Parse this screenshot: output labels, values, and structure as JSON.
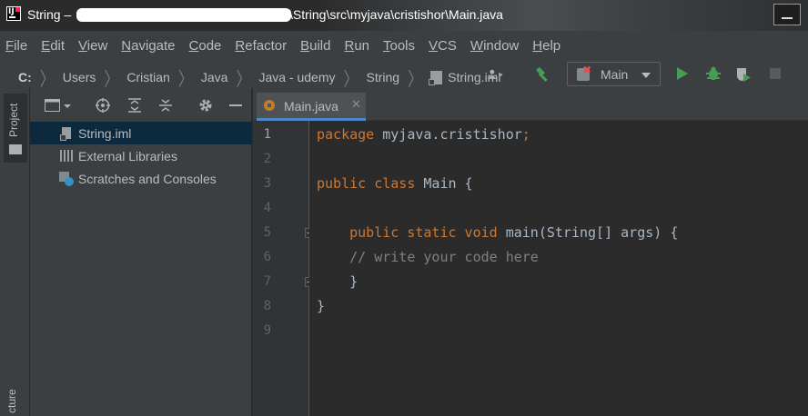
{
  "window": {
    "title_prefix": "String –",
    "title_path": "\\String\\src\\myjava\\cristishor\\Main.java"
  },
  "menu": [
    {
      "label": "File",
      "mnemonic": "F",
      "rest": "ile"
    },
    {
      "label": "Edit",
      "mnemonic": "E",
      "rest": "dit"
    },
    {
      "label": "View",
      "mnemonic": "V",
      "rest": "iew"
    },
    {
      "label": "Navigate",
      "mnemonic": "N",
      "rest": "avigate"
    },
    {
      "label": "Code",
      "mnemonic": "C",
      "rest": "ode"
    },
    {
      "label": "Refactor",
      "mnemonic": "R",
      "rest": "efactor"
    },
    {
      "label": "Build",
      "mnemonic": "B",
      "rest": "uild"
    },
    {
      "label": "Run",
      "mnemonic": "R",
      "rest": "un"
    },
    {
      "label": "Tools",
      "mnemonic": "T",
      "rest": "ools"
    },
    {
      "label": "VCS",
      "mnemonic": "V",
      "rest": "CS"
    },
    {
      "label": "Window",
      "mnemonic": "W",
      "rest": "indow"
    },
    {
      "label": "Help",
      "mnemonic": "H",
      "rest": "elp"
    }
  ],
  "breadcrumbs": [
    "C:",
    "Users",
    "Cristian",
    "Java",
    "Java - udemy",
    "String",
    "String.iml"
  ],
  "toolbar": {
    "run_config_label": "Main",
    "icons": [
      "user-icon",
      "hammer-icon",
      "run-icon",
      "debug-icon",
      "coverage-icon",
      "stop-icon"
    ]
  },
  "tool_strip": {
    "project_label": "Project",
    "structure_label": "cture"
  },
  "project_tree": {
    "items": [
      {
        "label": "String.iml",
        "icon": "file-icon",
        "selected": true
      },
      {
        "label": "External Libraries",
        "icon": "library-icon",
        "selected": false
      },
      {
        "label": "Scratches and Consoles",
        "icon": "scratch-icon",
        "selected": false
      }
    ]
  },
  "editor": {
    "tab_label": "Main.java",
    "current_line": 1,
    "line_numbers": [
      "1",
      "2",
      "3",
      "4",
      "5",
      "6",
      "7",
      "8",
      "9"
    ],
    "lines": {
      "l1_kw": "package",
      "l1_rest": " myjava.cristishor",
      "l1_semi": ";",
      "l3_kw": "public class",
      "l3_rest": " Main {",
      "l5_kw": "public static void",
      "l5_rest": " main(String[] args) {",
      "l6_comment": "// write your code here",
      "l7": "}",
      "l8": "}"
    }
  },
  "colors": {
    "keyword": "#cc7832",
    "comment": "#808080",
    "identifier": "#a9b7c6",
    "selection": "#0d293e",
    "tab_underline": "#4a88c7"
  }
}
